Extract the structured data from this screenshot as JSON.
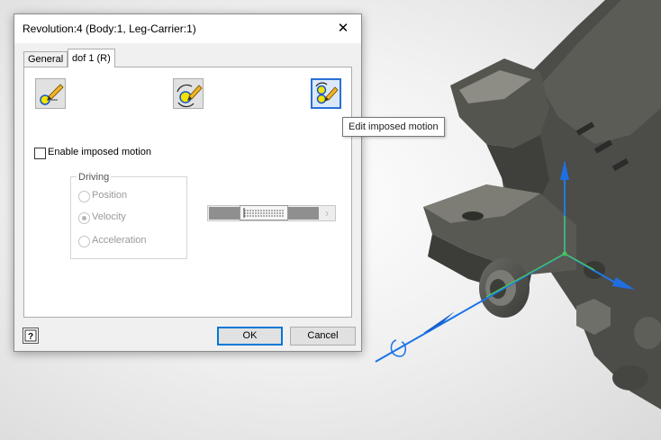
{
  "dialog": {
    "title": "Revolution:4 (Body:1, Leg-Carrier:1)",
    "close_glyph": "✕",
    "tabs": [
      {
        "label": "General",
        "active": false
      },
      {
        "label": "dof 1 (R)",
        "active": true
      }
    ],
    "tools": [
      {
        "icon": "edit-initial-condition-icon"
      },
      {
        "icon": "edit-joint-friction-icon"
      },
      {
        "icon": "edit-imposed-motion-icon",
        "selected": true
      }
    ],
    "enable_imposed_motion": {
      "label": "Enable imposed motion",
      "checked": false
    },
    "driving": {
      "title": "Driving",
      "options": [
        {
          "label": "Position",
          "checked": false
        },
        {
          "label": "Velocity",
          "checked": true
        },
        {
          "label": "Acceleration",
          "checked": false
        }
      ]
    },
    "slider": {
      "arrow_glyph": "›"
    },
    "buttons": {
      "ok": "OK",
      "cancel": "Cancel"
    },
    "help_glyph": "?"
  },
  "tooltip": {
    "text": "Edit imposed motion"
  },
  "colors": {
    "accent": "#0078d7",
    "axis_blue": "#1a73e8",
    "axis_green": "#38b84a",
    "model": "#4e4e4a"
  }
}
